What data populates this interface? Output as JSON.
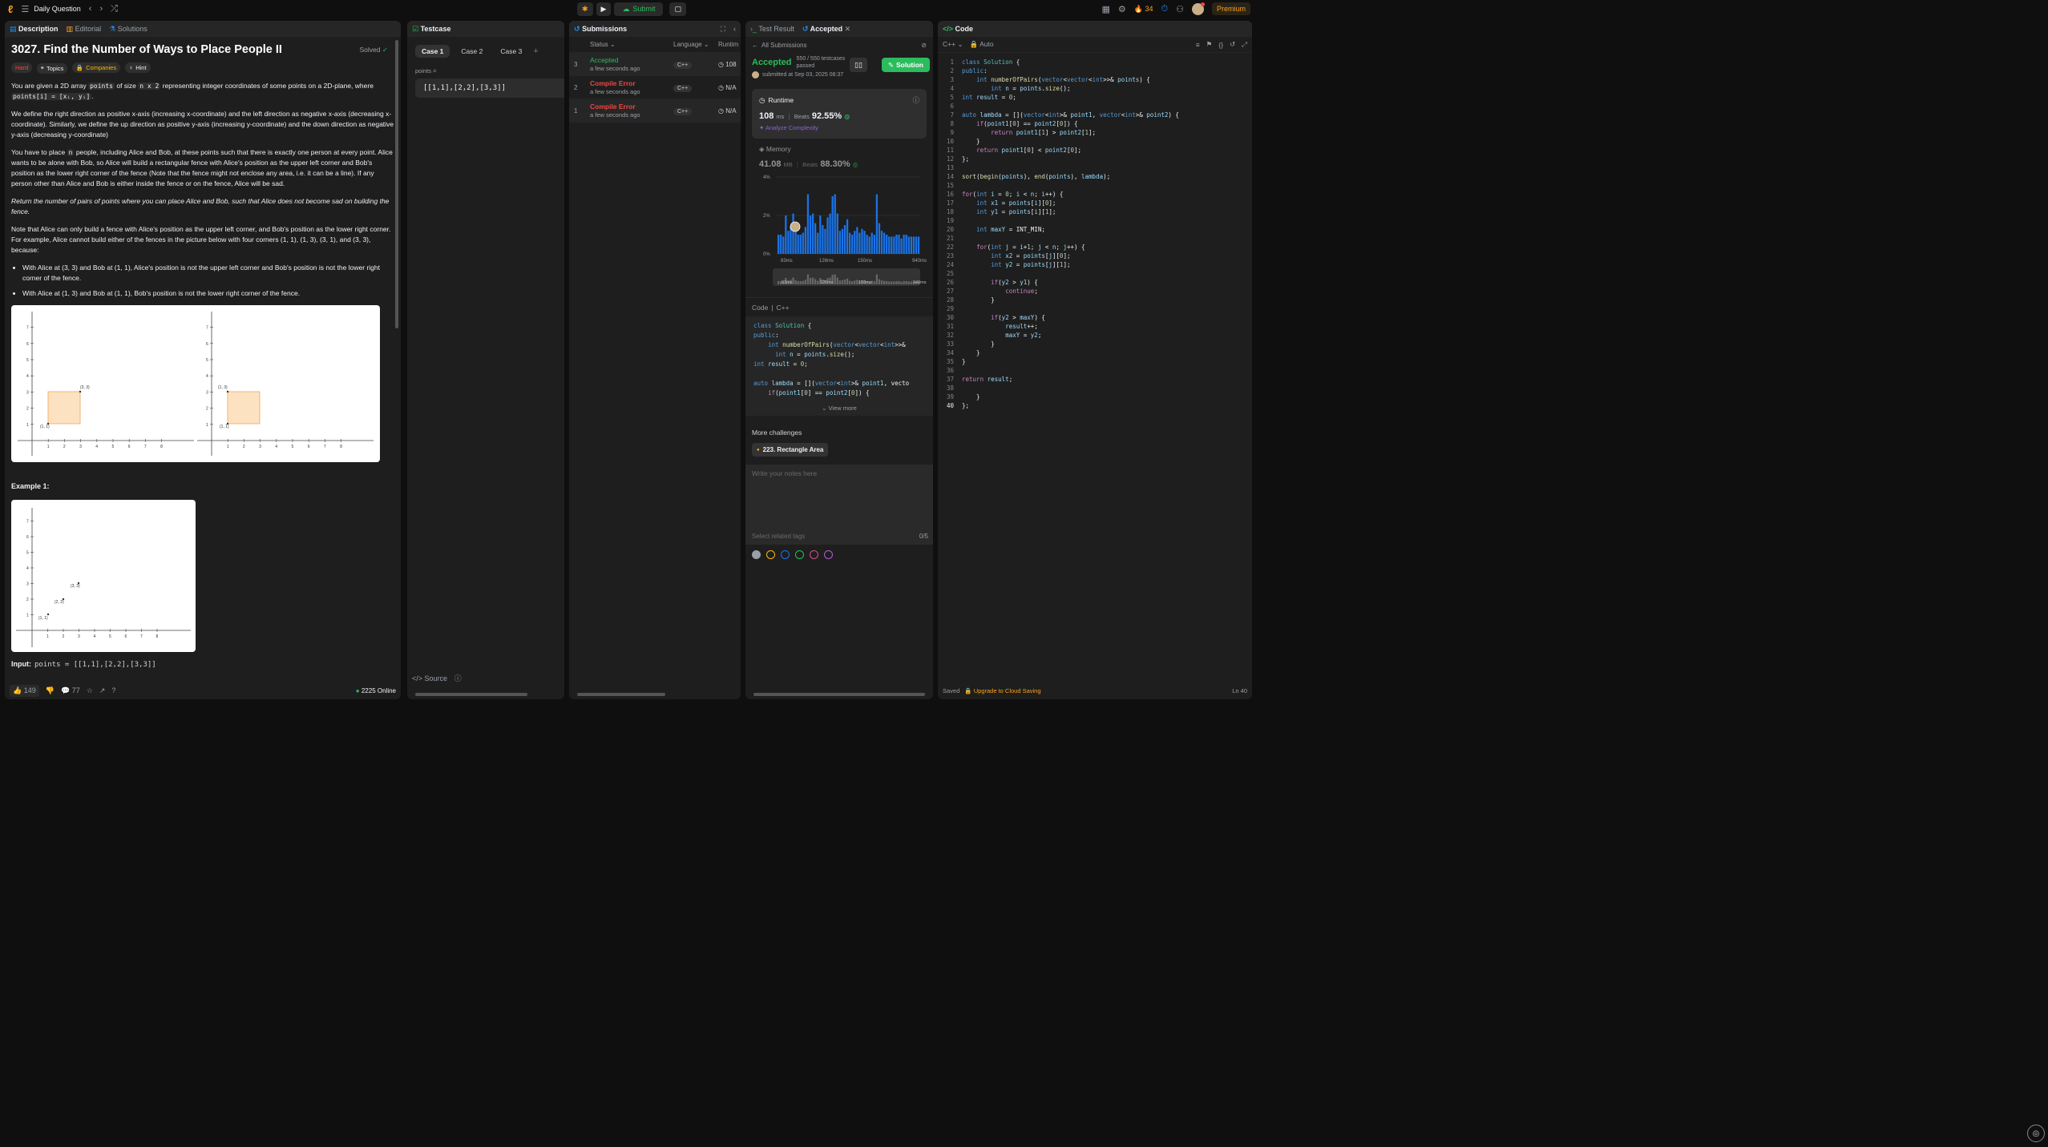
{
  "topbar": {
    "title": "Daily Question",
    "submit_label": "Submit",
    "streak": "34",
    "premium": "Premium"
  },
  "description": {
    "tabs": [
      "Description",
      "Editorial",
      "Solutions"
    ],
    "title": "3027. Find the Number of Ways to Place People II",
    "solved": "Solved",
    "difficulty": "Hard",
    "tags": [
      "Topics",
      "Companies",
      "Hint"
    ],
    "p1a": "You are given a 2D array ",
    "p1code1": "points",
    "p1b": " of size ",
    "p1code2": "n x 2",
    "p1c": " representing integer coordinates of some points on a 2D-plane, where",
    "p1code3": "points[i] = [xᵢ, yᵢ]",
    "p1d": ".",
    "p2": "We define the right direction as positive x-axis (increasing x-coordinate) and the left direction as negative x-axis (decreasing x-coordinate). Similarly, we define the up direction as positive y-axis (increasing y-coordinate) and the down direction as negative y-axis (decreasing y-coordinate)",
    "p3a": "You have to place ",
    "p3code": "n",
    "p3b": " people, including Alice and Bob, at these points such that there is exactly one person at every point. Alice wants to be alone with Bob, so Alice will build a rectangular fence with Alice's position as the upper left corner and Bob's position as the lower right corner of the fence (Note that the fence might not enclose any area, i.e. it can be a line). If any person other than Alice and Bob is either inside the fence or on the fence, Alice will be sad.",
    "p4": "Return the number of pairs of points where you can place Alice and Bob, such that Alice does not become sad on building the fence.",
    "p5": "Note that Alice can only build a fence with Alice's position as the upper left corner, and Bob's position as the lower right corner. For example, Alice cannot build either of the fences in the picture below with four corners (1, 1), (1, 3), (3, 1), and (3, 3), because:",
    "bullet1": "With Alice at (3, 3) and Bob at (1, 1), Alice's position is not the upper left corner and Bob's position is not the lower right corner of the fence.",
    "bullet2": "With Alice at (1, 3) and Bob at (1, 1), Bob's position is not the lower right corner of the fence.",
    "example_title": "Example 1:",
    "input_label": "Input:",
    "input_value": "points = [[1,1],[2,2],[3,3]]",
    "likes": "149",
    "comments": "77",
    "online": "2225 Online",
    "fig_labels": {
      "p11": "(1, 1)",
      "p33": "(3, 3)",
      "p13": "(1, 3)",
      "p22": "(2, 2)",
      "p33b": "(3, 3)"
    },
    "axis_ticks": [
      "1",
      "2",
      "3",
      "4",
      "5",
      "6",
      "7",
      "8"
    ]
  },
  "testcase": {
    "title": "Testcase",
    "cases": [
      "Case 1",
      "Case 2",
      "Case 3"
    ],
    "param_label": "points =",
    "param_value": "[[1,1],[2,2],[3,3]]",
    "source": "Source"
  },
  "submissions": {
    "title": "Submissions",
    "col_status": "Status",
    "col_language": "Language",
    "col_runtime": "Runtim",
    "rows": [
      {
        "num": "3",
        "status": "Accepted",
        "time": "a few seconds ago",
        "lang": "C++",
        "runtime": "108",
        "status_color": "#2cbb5d"
      },
      {
        "num": "2",
        "status": "Compile Error",
        "time": "a few seconds ago",
        "lang": "C++",
        "runtime": "N/A",
        "status_color": "#ef4743"
      },
      {
        "num": "1",
        "status": "Compile Error",
        "time": "a few seconds ago",
        "lang": "C++",
        "runtime": "N/A",
        "status_color": "#ef4743"
      }
    ]
  },
  "result": {
    "tab1": "Test Result",
    "tab2": "Accepted",
    "all_subs": "All Submissions",
    "accepted": "Accepted",
    "testcases": "550 / 550 testcases passed",
    "submitted": "submitted at Sep 03, 2025 08:37",
    "solution_btn": "Solution",
    "runtime_label": "Runtime",
    "runtime_value": "108",
    "runtime_unit": "ms",
    "beats_label": "Beats",
    "runtime_beats": "92.55%",
    "analyze": "Analyze Complexity",
    "memory_label": "Memory",
    "memory_value": "41.08",
    "memory_unit": "MB",
    "memory_beats": "88.30%",
    "code_label": "Code",
    "code_lang": "C++",
    "view_more": "View more",
    "more_challenges": "More challenges",
    "challenge": "223. Rectangle Area",
    "notes_placeholder": "Write your notes here",
    "tags_placeholder": "Select related tags",
    "tags_count": "0/5",
    "note_colors": [
      "#9aa0a6",
      "#ffb800",
      "#1a73e8",
      "#2cbb5d",
      "#e34c8d",
      "#b85ad8"
    ],
    "snippet": [
      "class Solution {",
      "public:",
      "    int numberOfPairs(vector<vector<int>>&",
      "      int n = points.size();",
      "int result = 0;",
      "",
      "auto lambda = [](vector<int>& point1, vecto",
      "    if(point1[0] == point2[0]) {"
    ]
  },
  "chart_data": {
    "type": "bar",
    "title": "",
    "xlabel": "",
    "ylabel": "",
    "ylim": [
      0,
      4
    ],
    "y_ticks": [
      "4%",
      "2%",
      "0%"
    ],
    "x_ticks": [
      "83ms",
      "126ms",
      "150ms",
      "940ms"
    ],
    "values": [
      1.0,
      1.0,
      0.9,
      2.0,
      1.2,
      1.4,
      2.1,
      1.3,
      1.0,
      1.0,
      1.1,
      1.4,
      3.1,
      2.0,
      2.1,
      1.6,
      1.1,
      2.0,
      1.5,
      1.3,
      1.9,
      2.1,
      3.0,
      3.1,
      2.1,
      1.2,
      1.3,
      1.5,
      1.8,
      1.1,
      1.0,
      1.2,
      1.4,
      1.1,
      1.3,
      1.2,
      1.0,
      0.9,
      1.1,
      1.0,
      3.1,
      1.6,
      1.2,
      1.1,
      1.0,
      0.9,
      0.9,
      0.9,
      1.0,
      1.0,
      0.8,
      1.0,
      1.0,
      0.9,
      0.9,
      0.9,
      0.9,
      0.9
    ],
    "grid": true
  },
  "code": {
    "title": "Code",
    "lang": "C++",
    "mode": "Auto",
    "saved": "Saved",
    "upgrade": "Upgrade to Cloud Saving",
    "position": "Ln 40",
    "lines": [
      "class Solution {",
      "public:",
      "    int numberOfPairs(vector<vector<int>>& points) {",
      "        int n = points.size();",
      "int result = 0;",
      "",
      "auto lambda = [](vector<int>& point1, vector<int>& point2) {",
      "    if(point1[0] == point2[0]) {",
      "        return point1[1] > point2[1];",
      "    }",
      "    return point1[0] < point2[0];",
      "};",
      "",
      "sort(begin(points), end(points), lambda);",
      "",
      "for(int i = 0; i < n; i++) {",
      "    int x1 = points[i][0];",
      "    int y1 = points[i][1];",
      "",
      "    int maxY = INT_MIN;",
      "",
      "    for(int j = i+1; j < n; j++) {",
      "        int x2 = points[j][0];",
      "        int y2 = points[j][1];",
      "",
      "        if(y2 > y1) {",
      "            continue;",
      "        }",
      "",
      "        if(y2 > maxY) {",
      "            result++;",
      "            maxY = y2;",
      "        }",
      "    }",
      "}",
      "",
      "return result;",
      "",
      "    }",
      "};"
    ]
  }
}
